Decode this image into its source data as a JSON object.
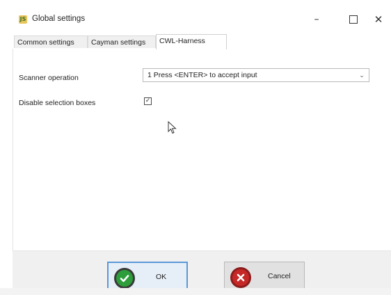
{
  "window": {
    "title": "Global settings",
    "app_icon_glyph": "JS",
    "minimize_glyph": "–",
    "close_glyph": "✕"
  },
  "tabs": [
    {
      "label": "Common settings",
      "active": false
    },
    {
      "label": "Cayman settings",
      "active": false
    },
    {
      "label": "CWL-Harness",
      "active": true
    }
  ],
  "form": {
    "scanner_label": "Scanner operation",
    "scanner_value": "1 Press <ENTER> to accept input",
    "disable_label": "Disable selection boxes",
    "disable_checked": true,
    "check_glyph": "✓",
    "chevron_glyph": "⌄"
  },
  "buttons": {
    "ok_label": "OK",
    "cancel_label": "Cancel"
  },
  "colors": {
    "ok_icon": "#2e9d3b",
    "cancel_icon": "#c62828",
    "focus_border": "#5a98d6"
  }
}
